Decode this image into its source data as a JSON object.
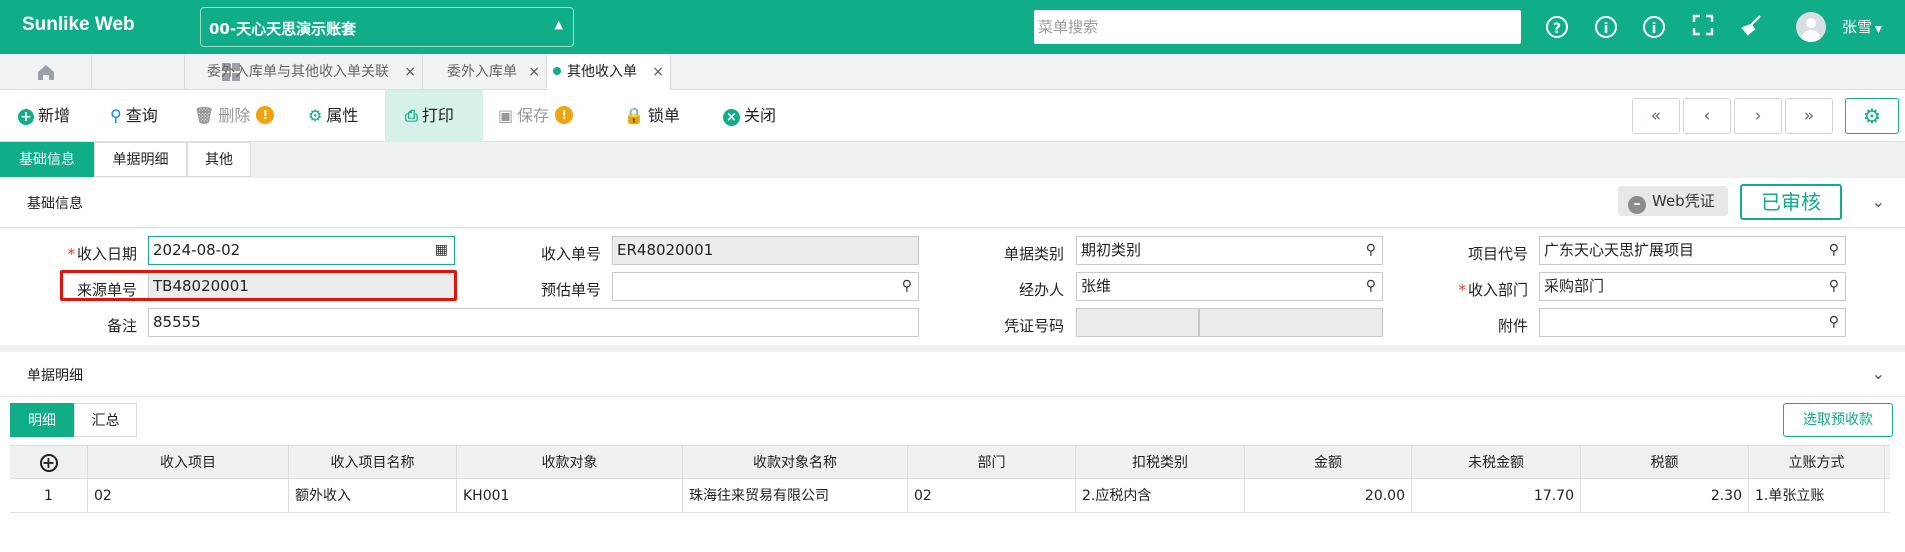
{
  "header": {
    "brand": "Sunlike Web",
    "account": "00-天心天思演示账套",
    "search_placeholder": "菜单搜索",
    "username": "张雪",
    "icons": [
      "question-circle-icon",
      "info-circle-icon",
      "info-circle-icon",
      "fullscreen-icon",
      "broom-icon"
    ]
  },
  "tabs": [
    {
      "label": "委外入库单与其他收入单关联",
      "active": false
    },
    {
      "label": "委外入库单",
      "active": false
    },
    {
      "label": "其他收入单",
      "active": true
    }
  ],
  "toolbar": {
    "new": "新增",
    "query": "查询",
    "delete": "删除",
    "properties": "属性",
    "print": "打印",
    "save": "保存",
    "lock": "锁单",
    "close": "关闭"
  },
  "subtabs": [
    "基础信息",
    "单据明细",
    "其他"
  ],
  "basic": {
    "section_title": "基础信息",
    "web_voucher": "Web凭证",
    "status": "已审核",
    "fields": {
      "receive_date": {
        "label": "收入日期",
        "value": "2024-08-02"
      },
      "receive_no": {
        "label": "收入单号",
        "value": "ER48020001"
      },
      "doc_type": {
        "label": "单据类别",
        "value": "期初类别"
      },
      "project_code": {
        "label": "项目代号",
        "value": "广东天心天思扩展项目"
      },
      "source_no": {
        "label": "来源单号",
        "value": "TB48020001"
      },
      "estimate_no": {
        "label": "预估单号",
        "value": ""
      },
      "handler": {
        "label": "经办人",
        "value": "张维"
      },
      "receive_dept": {
        "label": "收入部门",
        "value": "采购部门"
      },
      "remark": {
        "label": "备注",
        "value": "85555"
      },
      "voucher_no": {
        "label": "凭证号码",
        "value": ""
      },
      "attachment": {
        "label": "附件",
        "value": ""
      }
    }
  },
  "detail": {
    "section_title": "单据明细",
    "tabs": [
      "明细",
      "汇总"
    ],
    "select_prepayment": "选取预收款",
    "columns": [
      "收入项目",
      "收入项目名称",
      "收款对象",
      "收款对象名称",
      "部门",
      "扣税类别",
      "金额",
      "未税金额",
      "税额",
      "立账方式"
    ],
    "rows": [
      [
        "1",
        "02",
        "额外收入",
        "KH001",
        "珠海往来贸易有限公司",
        "02",
        "2.应税内含",
        "20.00",
        "17.70",
        "2.30",
        "1.单张立账"
      ]
    ]
  }
}
